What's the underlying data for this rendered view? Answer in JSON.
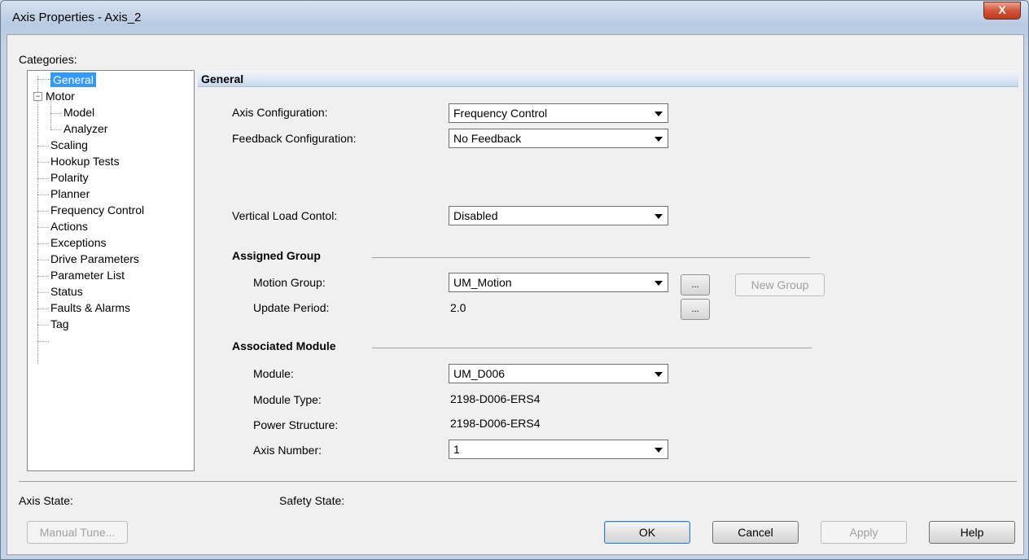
{
  "window": {
    "title": "Axis Properties - Axis_2",
    "close_label": "X"
  },
  "categories_label": "Categories:",
  "tree": {
    "general": "General",
    "motor": "Motor",
    "model": "Model",
    "analyzer": "Analyzer",
    "scaling": "Scaling",
    "hookup_tests": "Hookup Tests",
    "polarity": "Polarity",
    "planner": "Planner",
    "frequency_control": "Frequency Control",
    "actions": "Actions",
    "exceptions": "Exceptions",
    "drive_parameters": "Drive Parameters",
    "parameter_list": "Parameter List",
    "status": "Status",
    "faults_alarms": "Faults & Alarms",
    "tag": "Tag",
    "expander_symbol": "−"
  },
  "section_title": "General",
  "form": {
    "axis_config_label": "Axis Configuration:",
    "axis_config_value": "Frequency Control",
    "feedback_config_label": "Feedback Configuration:",
    "feedback_config_value": "No Feedback",
    "vertical_load_label": "Vertical Load Contol:",
    "vertical_load_value": "Disabled"
  },
  "assigned_group": {
    "heading": "Assigned Group",
    "motion_group_label": "Motion Group:",
    "motion_group_value": "UM_Motion",
    "ellipsis": "...",
    "new_group_label": "New Group",
    "update_period_label": "Update Period:",
    "update_period_value": "2.0"
  },
  "associated_module": {
    "heading": "Associated Module",
    "module_label": "Module:",
    "module_value": "UM_D006",
    "module_type_label": "Module Type:",
    "module_type_value": "2198-D006-ERS4",
    "power_structure_label": "Power Structure:",
    "power_structure_value": "2198-D006-ERS4",
    "axis_number_label": "Axis Number:",
    "axis_number_value": "1"
  },
  "footer": {
    "axis_state_label": "Axis State:",
    "safety_state_label": "Safety State:",
    "manual_tune": "Manual Tune...",
    "ok": "OK",
    "cancel": "Cancel",
    "apply": "Apply",
    "help": "Help"
  }
}
